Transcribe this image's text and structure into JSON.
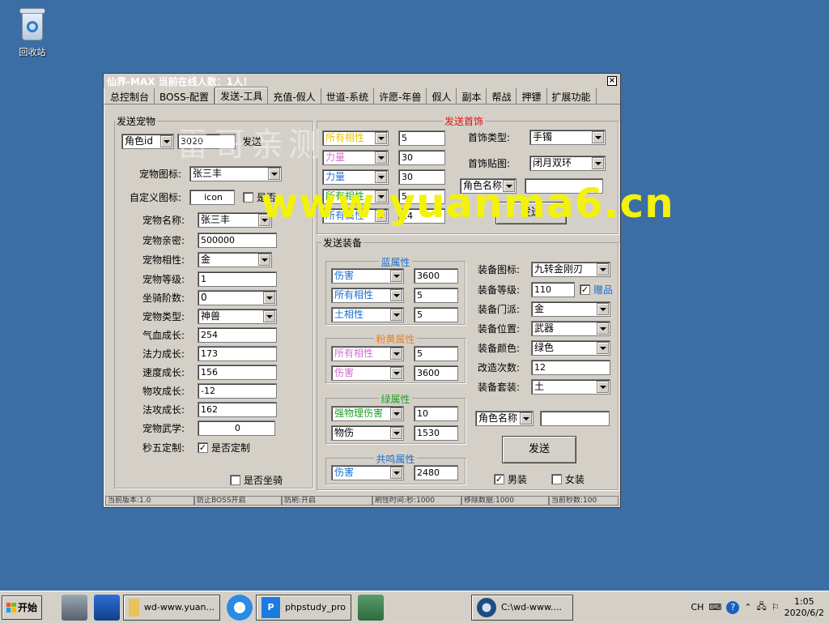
{
  "desktop": {
    "recycle_label": "回收站"
  },
  "window": {
    "title": "仙界-MAX   当前在线人数：1人！",
    "tabs": [
      "总控制台",
      "BOSS-配置",
      "发送-工具",
      "充值-假人",
      "世道-系统",
      "许愿-年兽",
      "假人",
      "副本",
      "帮战",
      "押镖",
      "扩展功能"
    ],
    "active_tab": 2
  },
  "pet": {
    "legend": "发送宠物",
    "id_select": "角色id",
    "id_value": "3020",
    "send_label": "发送",
    "icon_label": "宠物图标:",
    "icon_value": "张三丰",
    "custom_icon_label": "自定义图标:",
    "custom_icon_value": "icon",
    "custom_icon_check": "是否",
    "fields": [
      {
        "label": "宠物名称:",
        "value": "张三丰",
        "type": "select"
      },
      {
        "label": "宠物亲密:",
        "value": "500000",
        "type": "input"
      },
      {
        "label": "宠物相性:",
        "value": "金",
        "type": "select"
      },
      {
        "label": "宠物等级:",
        "value": "1",
        "type": "input"
      },
      {
        "label": "坐骑阶数:",
        "value": "0",
        "type": "select"
      },
      {
        "label": "宠物类型:",
        "value": "神兽",
        "type": "select"
      },
      {
        "label": "气血成长:",
        "value": "254",
        "type": "input"
      },
      {
        "label": "法力成长:",
        "value": "173",
        "type": "input"
      },
      {
        "label": "速度成长:",
        "value": "156",
        "type": "input"
      },
      {
        "label": "物攻成长:",
        "value": "-12",
        "type": "input"
      },
      {
        "label": "法攻成长:",
        "value": "162",
        "type": "input"
      },
      {
        "label": "宠物武学:",
        "value": "0",
        "type": "input"
      }
    ],
    "miao_label": "秒五定制:",
    "miao_check": "是否定制",
    "mount_check": "是否坐骑"
  },
  "jewelry": {
    "legend": "发送首饰",
    "attrs": [
      {
        "name": "所有相性",
        "value": "5",
        "color": "#e8c400"
      },
      {
        "name": "力量",
        "value": "30",
        "color": "#d070d0"
      },
      {
        "name": "力量",
        "value": "30",
        "color": "#2a6fd6"
      },
      {
        "name": "所有相性",
        "value": "5",
        "color": "#22a022"
      },
      {
        "name": "所有属性",
        "value": "24",
        "color": "#2a6fd6"
      }
    ],
    "type_label": "首饰类型:",
    "type_value": "手镯",
    "tex_label": "首饰贴图:",
    "tex_value": "闭月双环",
    "role_select": "角色名称",
    "send_label": "发送"
  },
  "equip": {
    "legend": "发送装备",
    "blue_caption": "蓝属性",
    "blue": [
      {
        "name": "伤害",
        "value": "3600"
      },
      {
        "name": "所有相性",
        "value": "5"
      },
      {
        "name": "土相性",
        "value": "5"
      }
    ],
    "pink_caption": "粉黄属性",
    "pink": [
      {
        "name": "所有相性",
        "value": "5",
        "color": "#d070d0"
      },
      {
        "name": "伤害",
        "value": "3600",
        "color": "#d070d0"
      }
    ],
    "green_caption": "绿属性",
    "green": [
      {
        "name": "强物理伤害",
        "value": "10",
        "color": "#22a022"
      },
      {
        "name": "物伤",
        "value": "1530",
        "color": "#000000"
      }
    ],
    "resonance_caption": "共鸣属性",
    "resonance": [
      {
        "name": "伤害",
        "value": "2480"
      }
    ],
    "right": [
      {
        "label": "装备图标:",
        "value": "九转金刚刃",
        "type": "select"
      },
      {
        "label": "装备等级:",
        "value": "110",
        "type": "input"
      },
      {
        "label": "装备门派:",
        "value": "金",
        "type": "select"
      },
      {
        "label": "装备位置:",
        "value": "武器",
        "type": "select"
      },
      {
        "label": "装备颜色:",
        "value": "绿色",
        "type": "select"
      },
      {
        "label": "改造次数:",
        "value": "12",
        "type": "input"
      },
      {
        "label": "装备套装:",
        "value": "土",
        "type": "select"
      }
    ],
    "gift_label": "赠品",
    "role_select": "角色名称",
    "send_label": "发送",
    "male_label": "男装",
    "female_label": "女装"
  },
  "statusbar": [
    "当前版本:1.0",
    "防止BOSS开启",
    "防刷:开启",
    "刷怪时间:秒:1000",
    "移除数据:1000",
    "当前秒数:100"
  ],
  "watermark": {
    "cn": "雷哥亲测",
    "url": "www.yuanma6.cn"
  },
  "taskbar": {
    "start": "开始",
    "items": [
      "wd-www.yuan...",
      "phpstudy_pro",
      "C:\\wd-www...."
    ],
    "lang": "CH",
    "time": "1:05",
    "date": "2020/6/2"
  },
  "colors": {
    "desktop": "#3a6ea5",
    "window": "#d4d0c8",
    "red_legend": "#e01010",
    "blue_caption": "#1a6fd0",
    "pink_caption": "#f08020",
    "green_caption": "#22a022"
  }
}
